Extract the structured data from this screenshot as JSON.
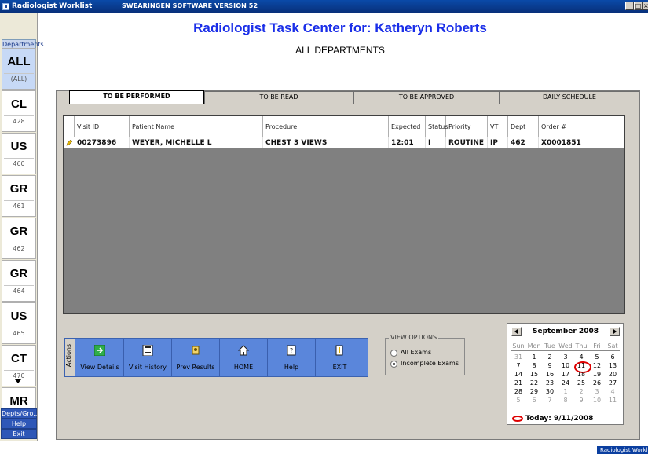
{
  "window": {
    "title": "Radiologist Worklist",
    "version": "SWEARINGEN SOFTWARE VERSION 52"
  },
  "header": {
    "title": "Radiologist Task Center for:  Katheryn  Roberts",
    "subtitle": "ALL DEPARTMENTS"
  },
  "sidebar": {
    "header": "Departments",
    "departments": [
      {
        "code": "ALL",
        "num": "(ALL)",
        "selected": true
      },
      {
        "code": "CL",
        "num": "428"
      },
      {
        "code": "US",
        "num": "460"
      },
      {
        "code": "GR",
        "num": "461"
      },
      {
        "code": "GR",
        "num": "462"
      },
      {
        "code": "GR",
        "num": "464"
      },
      {
        "code": "US",
        "num": "465"
      },
      {
        "code": "CT",
        "num": "470"
      },
      {
        "code": "MR",
        "num": ""
      }
    ],
    "bottom": [
      "Depts/Gro...",
      "Help",
      "Exit"
    ]
  },
  "tabs": [
    "TO BE PERFORMED",
    "TO BE READ",
    "TO BE APPROVED",
    "DAILY SCHEDULE"
  ],
  "grid": {
    "columns": [
      "Visit ID",
      "Patient Name",
      "Procedure",
      "Expected",
      "Status",
      "Priority",
      "VT",
      "Dept",
      "Order #"
    ],
    "rows": [
      [
        "00273896",
        "WEYER, MICHELLE L",
        "CHEST 3 VIEWS",
        "12:01",
        "I",
        "ROUTINE",
        "IP",
        "462",
        "X0001851"
      ]
    ]
  },
  "actions": {
    "label": "Actions",
    "buttons": [
      {
        "label": "View Details",
        "icon": "arrow-right-icon"
      },
      {
        "label": "Visit History",
        "icon": "history-icon"
      },
      {
        "label": "Prev Results",
        "icon": "results-icon"
      },
      {
        "label": "HOME",
        "icon": "home-icon"
      },
      {
        "label": "Help",
        "icon": "help-icon"
      },
      {
        "label": "EXIT",
        "icon": "exit-icon"
      }
    ]
  },
  "view_options": {
    "title": "VIEW OPTIONS",
    "all": "All Exams",
    "incomplete": "Incomplete Exams",
    "selected": "incomplete"
  },
  "calendar": {
    "month": "September 2008",
    "dow": [
      "Sun",
      "Mon",
      "Tue",
      "Wed",
      "Thu",
      "Fri",
      "Sat"
    ],
    "weeks": [
      [
        "31",
        "1",
        "2",
        "3",
        "4",
        "5",
        "6"
      ],
      [
        "7",
        "8",
        "9",
        "10",
        "11",
        "12",
        "13"
      ],
      [
        "14",
        "15",
        "16",
        "17",
        "18",
        "19",
        "20"
      ],
      [
        "21",
        "22",
        "23",
        "24",
        "25",
        "26",
        "27"
      ],
      [
        "28",
        "29",
        "30",
        "1",
        "2",
        "3",
        "4"
      ],
      [
        "5",
        "6",
        "7",
        "8",
        "9",
        "10",
        "11"
      ]
    ],
    "today_label": "Today: 9/11/2008"
  },
  "taskbar": {
    "label": "Radiologist Worklist"
  }
}
